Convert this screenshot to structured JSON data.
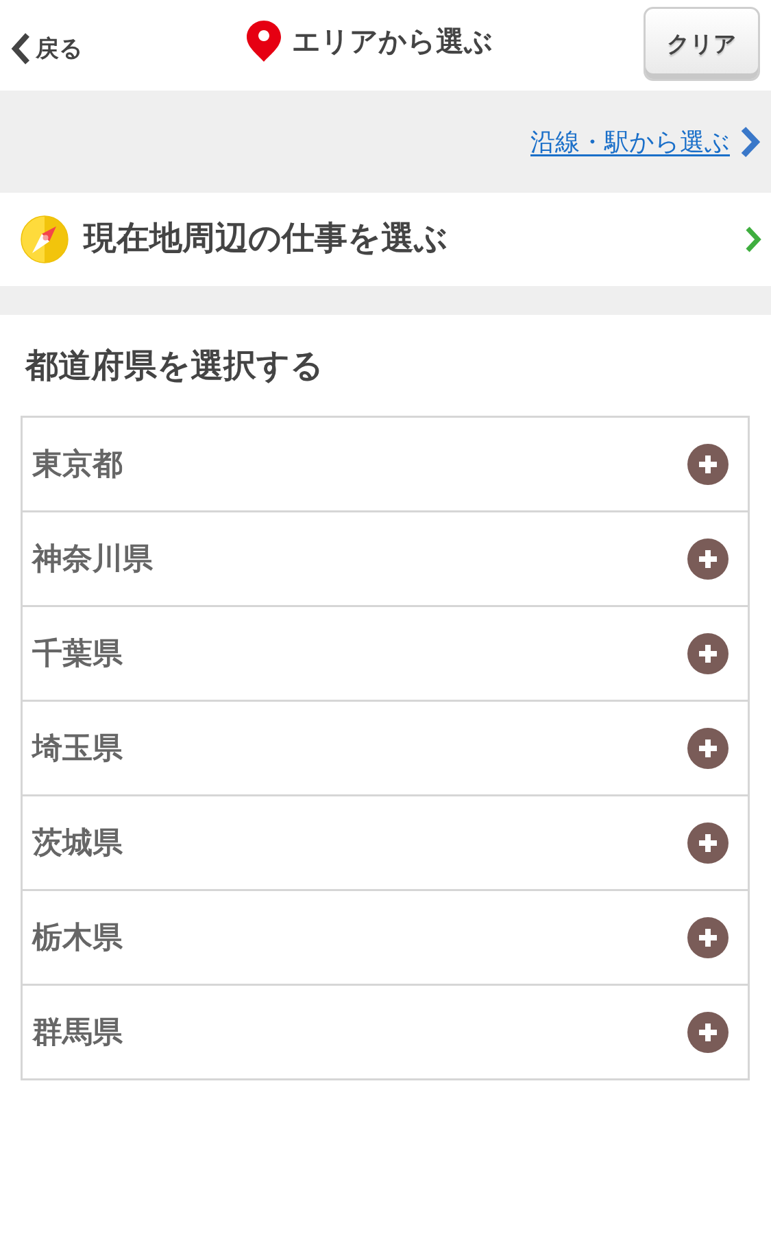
{
  "header": {
    "back_label": "戻る",
    "title": "エリアから選ぶ",
    "clear_button": "クリア"
  },
  "line_link": {
    "label": "沿線・駅から選ぶ"
  },
  "nearby": {
    "label": "現在地周辺の仕事を選ぶ"
  },
  "prefectures": {
    "heading": "都道府県を選択する",
    "items": [
      {
        "name": "東京都"
      },
      {
        "name": "神奈川県"
      },
      {
        "name": "千葉県"
      },
      {
        "name": "埼玉県"
      },
      {
        "name": "茨城県"
      },
      {
        "name": "栃木県"
      },
      {
        "name": "群馬県"
      }
    ]
  }
}
